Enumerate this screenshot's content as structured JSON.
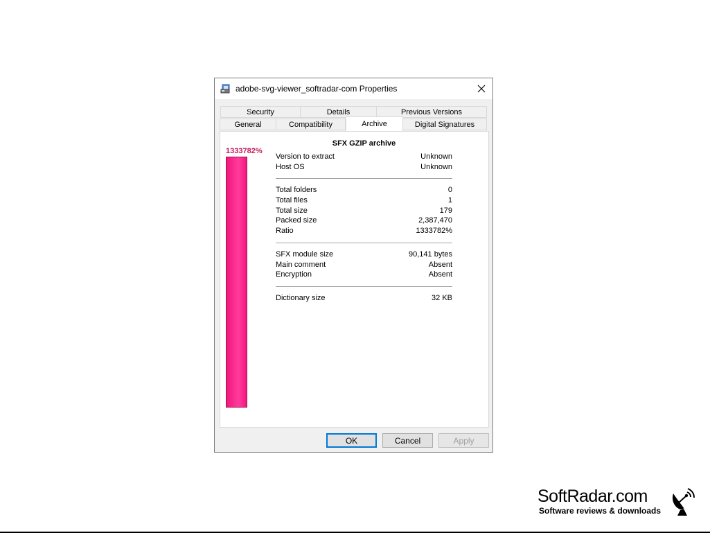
{
  "window": {
    "title": "adobe-svg-viewer_softradar-com Properties",
    "close_icon": "close-icon",
    "app_icon": "archive-file-icon"
  },
  "tabs": {
    "row1": [
      {
        "label": "Security"
      },
      {
        "label": "Details"
      },
      {
        "label": "Previous Versions"
      }
    ],
    "row2": [
      {
        "label": "General"
      },
      {
        "label": "Compatibility"
      },
      {
        "label": "Archive",
        "active": true
      },
      {
        "label": "Digital Signatures"
      }
    ]
  },
  "archive": {
    "heading": "SFX GZIP archive",
    "ratio_label": "1333782%",
    "bar_fill_fraction": 1.0,
    "bar_color": "#f2177e",
    "ratio_label_color": "#c2185b",
    "group1": [
      {
        "label": "Version to extract",
        "value": "Unknown"
      },
      {
        "label": "Host OS",
        "value": "Unknown"
      }
    ],
    "group2": [
      {
        "label": "Total folders",
        "value": "0"
      },
      {
        "label": "Total files",
        "value": "1"
      },
      {
        "label": "Total size",
        "value": "179"
      },
      {
        "label": "Packed size",
        "value": "2,387,470"
      },
      {
        "label": "Ratio",
        "value": "1333782%"
      }
    ],
    "group3": [
      {
        "label": "SFX module size",
        "value": "90,141 bytes"
      },
      {
        "label": "Main comment",
        "value": "Absent"
      },
      {
        "label": "Encryption",
        "value": "Absent"
      }
    ],
    "group4": [
      {
        "label": "Dictionary size",
        "value": "32 KB"
      }
    ]
  },
  "buttons": {
    "ok": "OK",
    "cancel": "Cancel",
    "apply": "Apply"
  },
  "brand": {
    "name": "SoftRadar.com",
    "tagline": "Software reviews & downloads",
    "icon": "satellite-dish-icon"
  }
}
